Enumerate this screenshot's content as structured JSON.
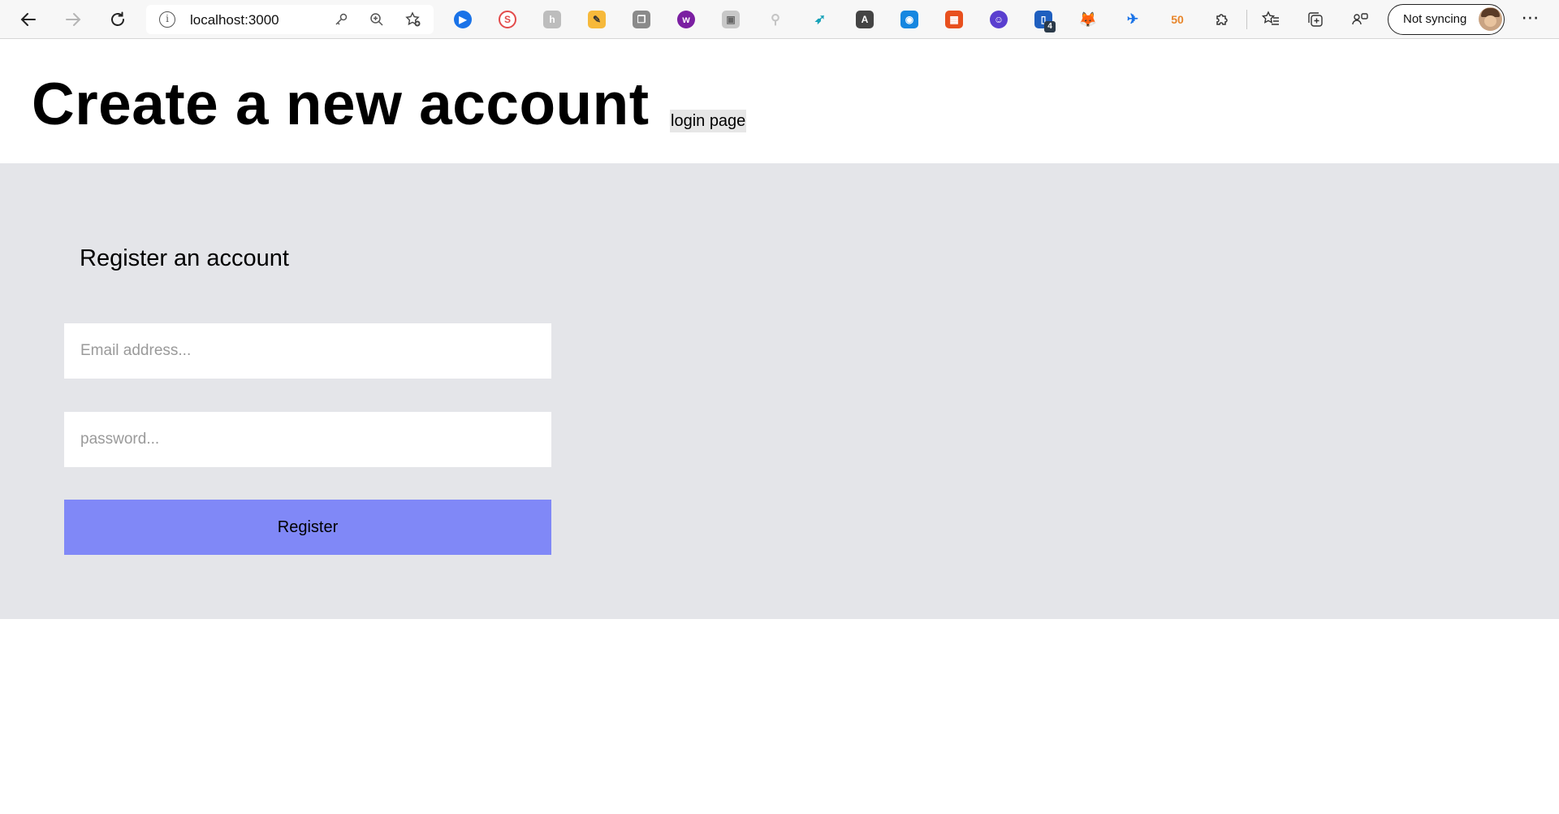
{
  "browser": {
    "url": "localhost:3000",
    "sync_label": "Not syncing",
    "back_icon": "back-arrow-icon",
    "forward_icon": "forward-arrow-icon",
    "refresh_icon": "refresh-icon",
    "extension_badge": "4"
  },
  "header": {
    "title": "Create a new account",
    "login_link": "login page"
  },
  "form": {
    "heading": "Register an account",
    "email_placeholder": "Email address...",
    "password_placeholder": "password...",
    "submit_label": "Register"
  },
  "colors": {
    "panel_bg": "#e4e5e9",
    "button_bg": "#8088f7",
    "link_bg": "#e6e6e6"
  }
}
